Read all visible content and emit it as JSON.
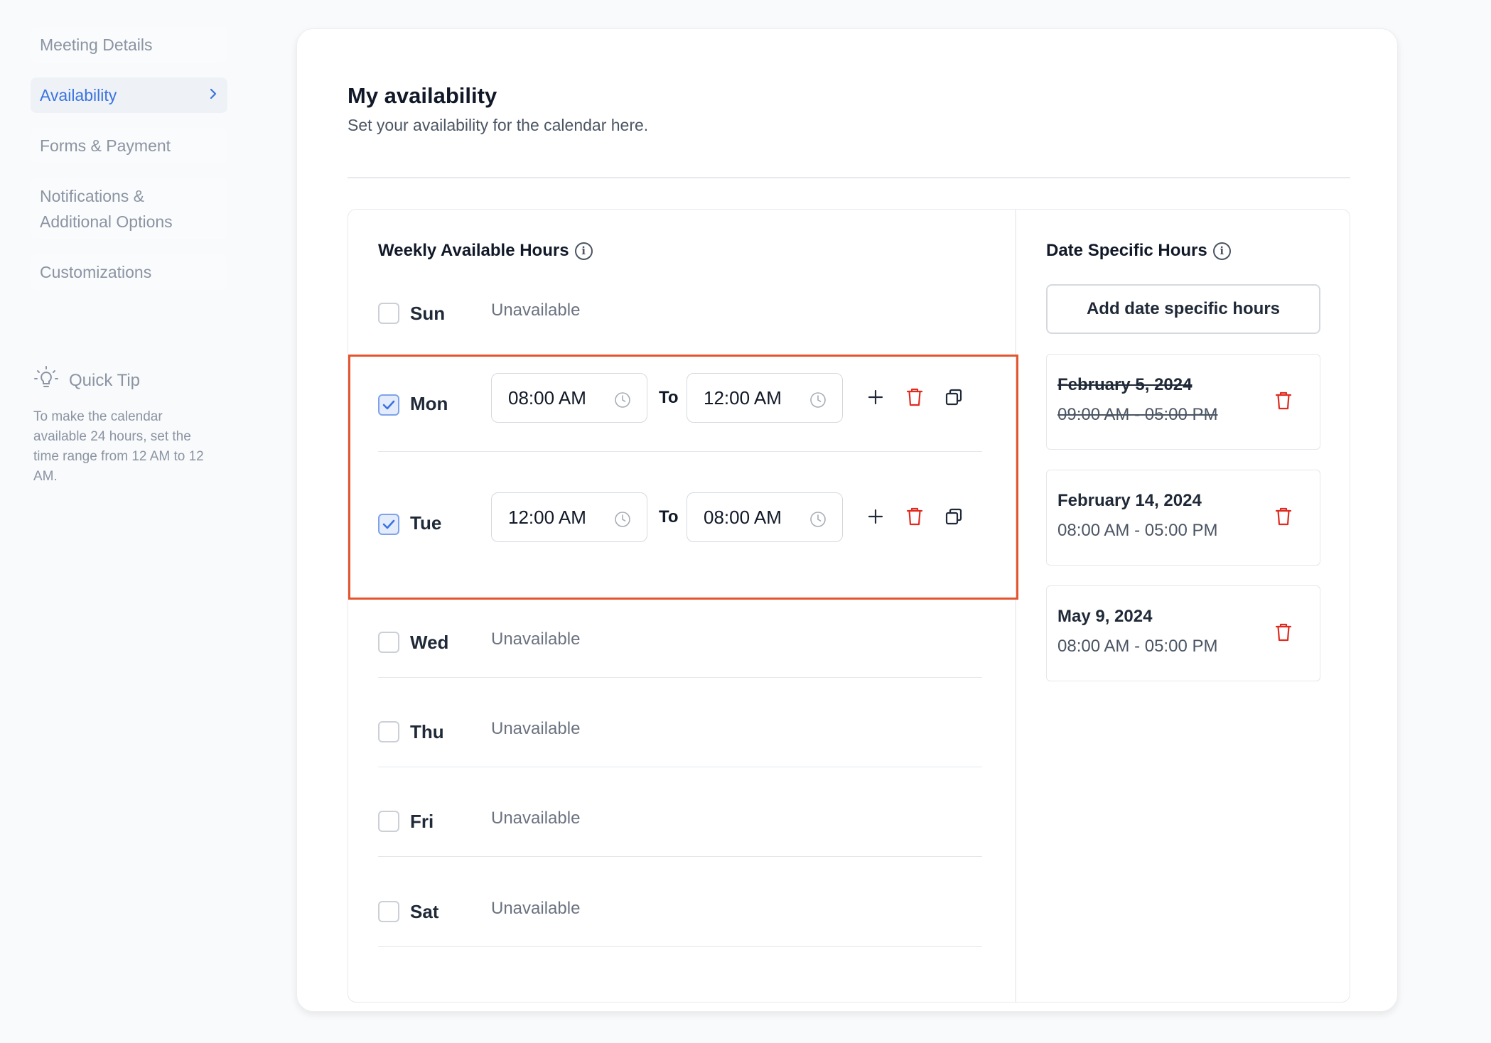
{
  "sidebar": {
    "items": [
      {
        "label": "Meeting Details"
      },
      {
        "label": "Availability"
      },
      {
        "label": "Forms & Payment"
      },
      {
        "label": "Notifications & Additional Options"
      },
      {
        "label": "Customizations"
      }
    ],
    "active_index": 1,
    "quick_tip": {
      "title": "Quick Tip",
      "text": "To make the calendar available 24 hours, set the time range from 12 AM to 12 AM."
    }
  },
  "main": {
    "title": "My availability",
    "subtitle": "Set your availability for the calendar here."
  },
  "weekly": {
    "title": "Weekly Available Hours",
    "to_label": "To",
    "unavailable_label": "Unavailable",
    "days": [
      {
        "name": "Sun",
        "checked": false
      },
      {
        "name": "Mon",
        "checked": true,
        "from": "08:00 AM",
        "to": "12:00 AM"
      },
      {
        "name": "Tue",
        "checked": true,
        "from": "12:00 AM",
        "to": "08:00 AM"
      },
      {
        "name": "Wed",
        "checked": false
      },
      {
        "name": "Thu",
        "checked": false
      },
      {
        "name": "Fri",
        "checked": false
      },
      {
        "name": "Sat",
        "checked": false
      }
    ]
  },
  "date_specific": {
    "title": "Date Specific Hours",
    "add_button": "Add date specific hours",
    "entries": [
      {
        "date": "February 5, 2024",
        "time": "09:00 AM - 05:00 PM",
        "struck": true
      },
      {
        "date": "February 14, 2024",
        "time": "08:00 AM - 05:00 PM",
        "struck": false
      },
      {
        "date": "May 9, 2024",
        "time": "08:00 AM - 05:00 PM",
        "struck": false
      }
    ]
  },
  "colors": {
    "accent": "#3b73e0",
    "danger": "#e02b20",
    "highlight_border": "#e4552e"
  }
}
